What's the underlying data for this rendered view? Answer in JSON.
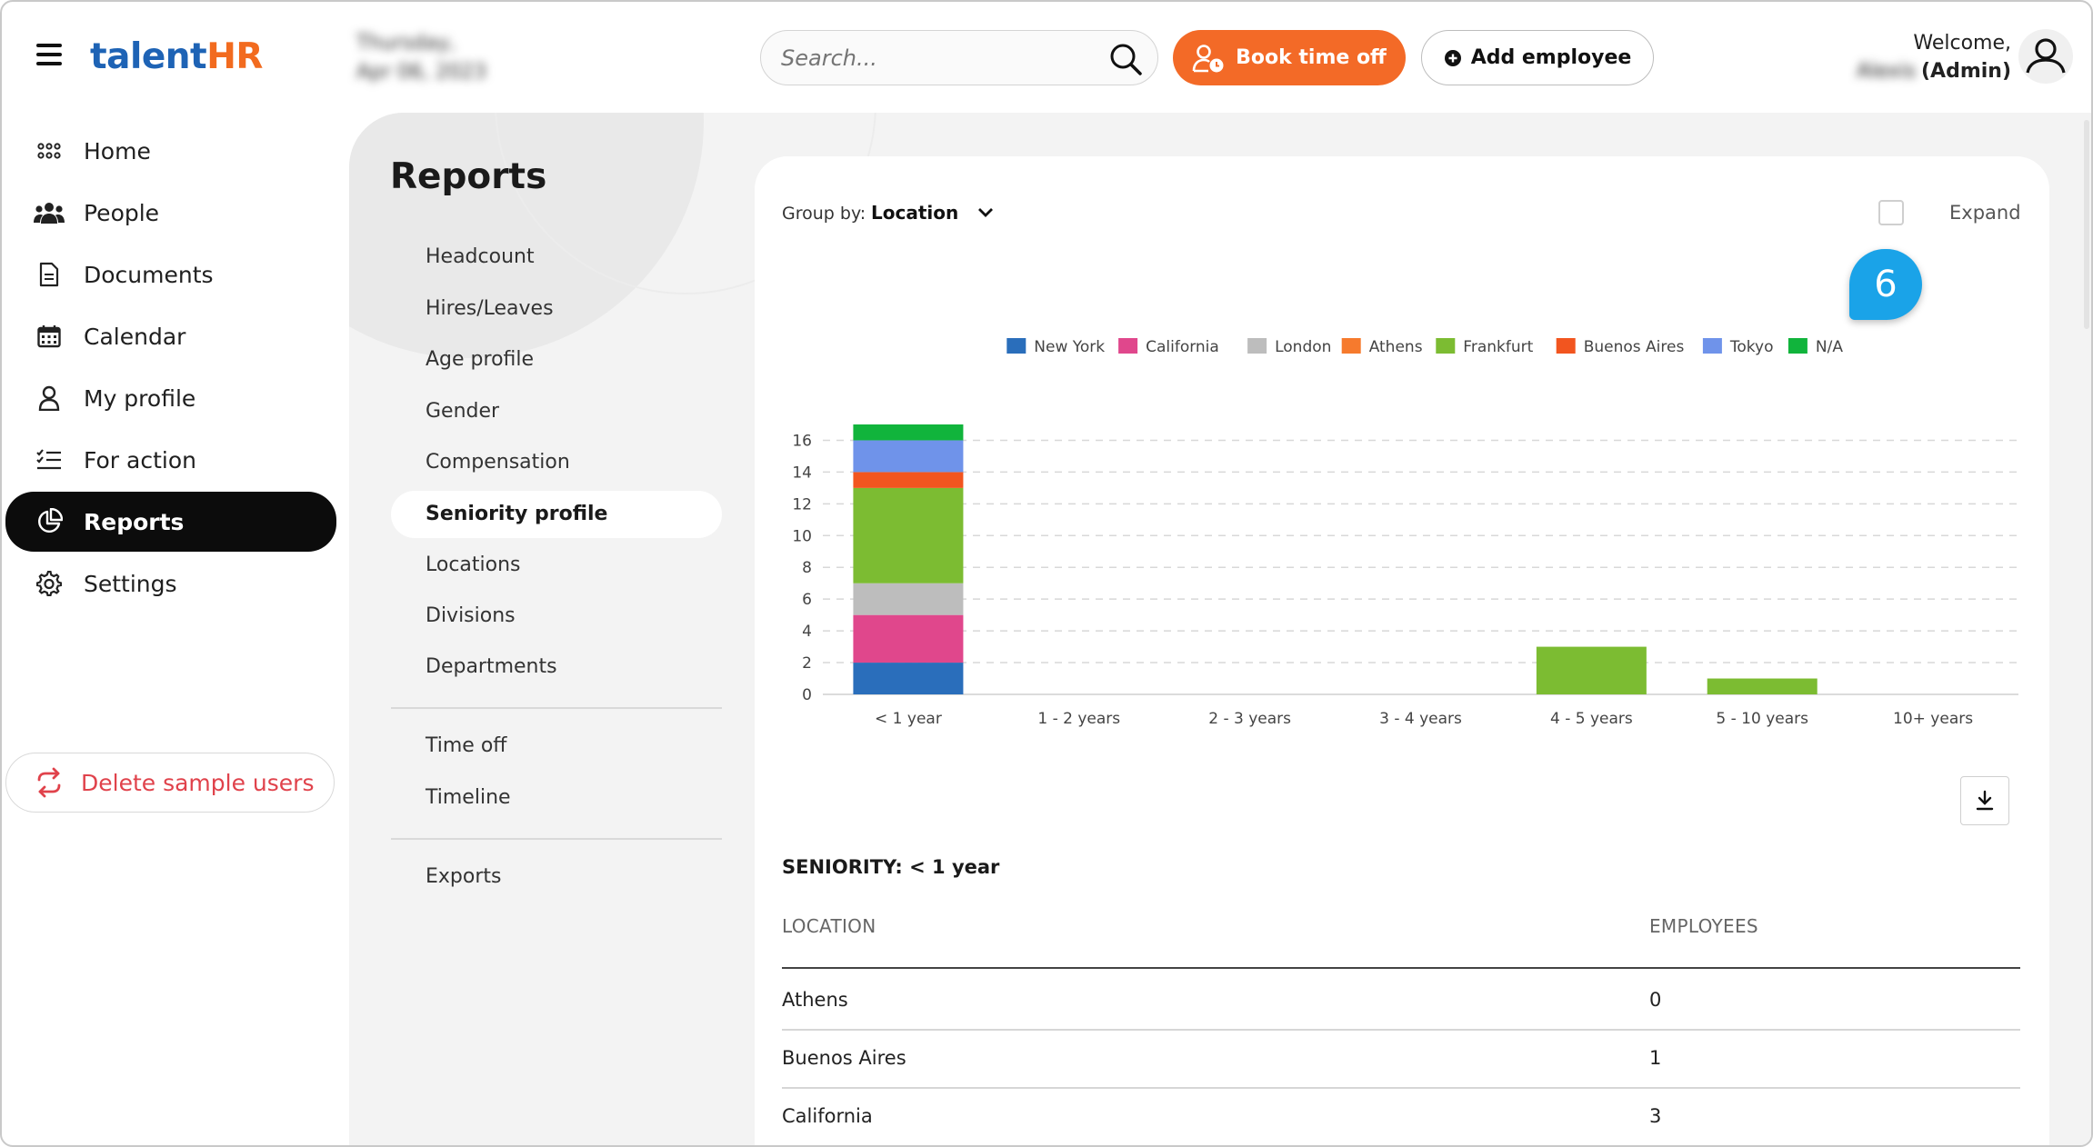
{
  "app": {
    "logo_part1": "talent",
    "logo_part2": "HR",
    "date_line1": "Thursday,",
    "date_line2": "Apr 06, 2023"
  },
  "search": {
    "placeholder": "Search..."
  },
  "header": {
    "book_label": "Book time off",
    "add_label": "Add employee",
    "welcome": "Welcome,",
    "user_name": "Alexis",
    "role": "(Admin)"
  },
  "sidebar": {
    "items": [
      {
        "label": "Home",
        "icon": "grid-icon"
      },
      {
        "label": "People",
        "icon": "people-icon"
      },
      {
        "label": "Documents",
        "icon": "document-icon"
      },
      {
        "label": "Calendar",
        "icon": "calendar-icon"
      },
      {
        "label": "My profile",
        "icon": "user-icon"
      },
      {
        "label": "For action",
        "icon": "checklist-icon"
      },
      {
        "label": "Reports",
        "icon": "pie-chart-icon"
      },
      {
        "label": "Settings",
        "icon": "gear-icon"
      }
    ],
    "delete_label": "Delete sample users"
  },
  "reports": {
    "title": "Reports",
    "menu": [
      "Headcount",
      "Hires/Leaves",
      "Age profile",
      "Gender",
      "Compensation",
      "Seniority profile",
      "Locations",
      "Divisions",
      "Departments"
    ],
    "menu2": [
      "Time off",
      "Timeline"
    ],
    "menu3": [
      "Exports"
    ],
    "active": "Seniority profile"
  },
  "controls": {
    "group_by_label": "Group by:",
    "group_by_value": "Location",
    "expand_label": "Expand",
    "callout_number": "6"
  },
  "chart_data": {
    "type": "bar",
    "stacked": true,
    "categories": [
      "< 1 year",
      "1 - 2 years",
      "2 - 3 years",
      "3 - 4 years",
      "4 - 5 years",
      "5 - 10 years",
      "10+ years"
    ],
    "series": [
      {
        "name": "New York",
        "color": "#2a6ebb",
        "values": [
          2,
          0,
          0,
          0,
          0,
          0,
          0
        ]
      },
      {
        "name": "California",
        "color": "#e0478c",
        "values": [
          3,
          0,
          0,
          0,
          0,
          0,
          0
        ]
      },
      {
        "name": "London",
        "color": "#bdbdbd",
        "values": [
          2,
          0,
          0,
          0,
          0,
          0,
          0
        ]
      },
      {
        "name": "Athens",
        "color": "#f67a2d",
        "values": [
          0,
          0,
          0,
          0,
          0,
          0,
          0
        ]
      },
      {
        "name": "Frankfurt",
        "color": "#7cbc32",
        "values": [
          6,
          0,
          0,
          0,
          3,
          1,
          0
        ]
      },
      {
        "name": "Buenos Aires",
        "color": "#f2551f",
        "values": [
          1,
          0,
          0,
          0,
          0,
          0,
          0
        ]
      },
      {
        "name": "Tokyo",
        "color": "#6f93ea",
        "values": [
          2,
          0,
          0,
          0,
          0,
          0,
          0
        ]
      },
      {
        "name": "N/A",
        "color": "#11b43c",
        "values": [
          1,
          0,
          0,
          0,
          0,
          0,
          0
        ]
      }
    ],
    "yticks": [
      0,
      2,
      4,
      6,
      8,
      10,
      12,
      14,
      16
    ],
    "ylim": [
      0,
      17
    ],
    "grid": true,
    "legend": "top"
  },
  "table": {
    "title": "SENIORITY:",
    "title_value": "< 1 year",
    "col_location": "LOCATION",
    "col_employees": "EMPLOYEES",
    "rows": [
      {
        "location": "Athens",
        "employees": "0"
      },
      {
        "location": "Buenos Aires",
        "employees": "1"
      },
      {
        "location": "California",
        "employees": "3"
      }
    ]
  }
}
